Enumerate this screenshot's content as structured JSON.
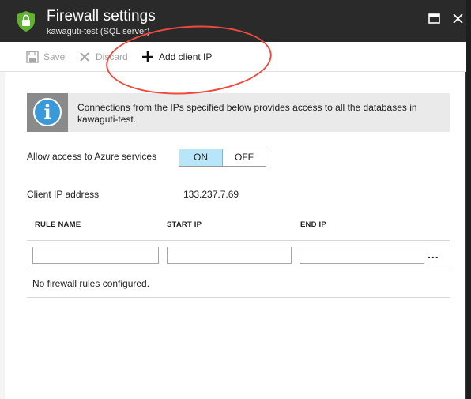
{
  "header": {
    "title": "Firewall settings",
    "subtitle": "kawaguti-test (SQL server)"
  },
  "toolbar": {
    "save_label": "Save",
    "discard_label": "Discard",
    "add_client_ip_label": "Add client IP"
  },
  "info": {
    "message": "Connections from the IPs specified below provides access to all the databases in kawaguti-test."
  },
  "azure_access": {
    "label": "Allow access to Azure services",
    "on_label": "ON",
    "off_label": "OFF",
    "selected": "ON"
  },
  "client_ip": {
    "label": "Client IP address",
    "value": "133.237.7.69"
  },
  "rules_table": {
    "columns": [
      "RULE NAME",
      "START IP",
      "END IP"
    ],
    "new_row": {
      "rule_name": "",
      "start_ip": "",
      "end_ip": ""
    },
    "more_label": "...",
    "empty_message": "No firewall rules configured."
  },
  "colors": {
    "header_bg": "#2a2a2a",
    "shield": "#5fb32e",
    "toggle_on": "#b8e6f8",
    "info_blue": "#3a9ad9",
    "annotation_red": "#ee4a3f"
  },
  "icons": {
    "shield": "shield-lock-icon",
    "maximize": "maximize-icon",
    "close": "close-icon",
    "save": "save-icon",
    "discard": "discard-x-icon",
    "add": "plus-icon",
    "info": "info-icon"
  }
}
